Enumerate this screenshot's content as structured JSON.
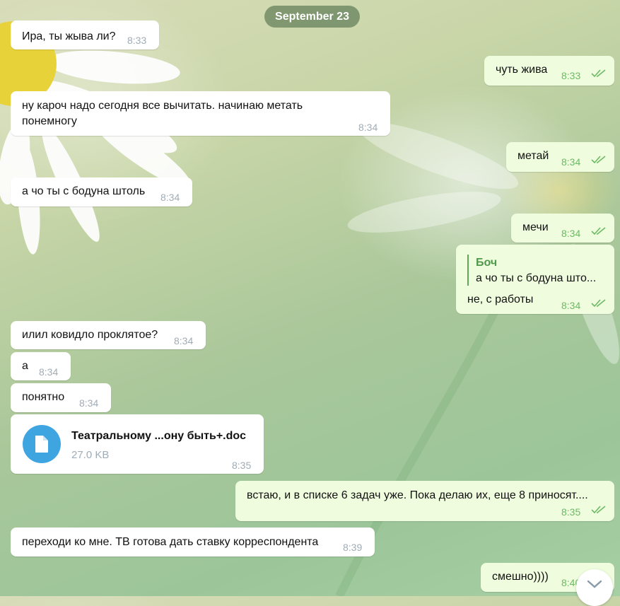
{
  "date_label": "September 23",
  "messages": [
    {
      "text": "Ира, ты жыва ли?",
      "time": "8:33"
    },
    {
      "text": "чуть жива",
      "time": "8:33"
    },
    {
      "text_line1": "ну кароч надо сегодня все вычитать. начинаю метать",
      "text_line2": "понемногу",
      "time": "8:34"
    },
    {
      "text": "метай",
      "time": "8:34"
    },
    {
      "text": "а чо ты с бодуна штоль",
      "time": "8:34"
    },
    {
      "text": "мечи",
      "time": "8:34"
    },
    {
      "reply_name": "Боч",
      "reply_text": "а чо ты с бодуна што...",
      "text": "не, с работы",
      "time": "8:34"
    },
    {
      "text": "илил ковидло проклятое?",
      "time": "8:34"
    },
    {
      "text": "а",
      "time": "8:34"
    },
    {
      "text": "понятно",
      "time": "8:34"
    },
    {
      "file_name": "Театральному ...ону быть+.doc",
      "file_size": "27.0 KB",
      "time": "8:35",
      "icon": "file-icon"
    },
    {
      "text": "встаю, и в списке 6 задач уже. Пока делаю их, еще 8 приносят....",
      "time": "8:35"
    },
    {
      "text": "переходи ко мне. ТВ готова дать ставку корреспондента",
      "time": "8:39"
    },
    {
      "text": "смешно))))",
      "time": "8:40"
    }
  ],
  "icons": {
    "read_receipt": "double-check-icon",
    "scroll": "chevron-down-icon"
  },
  "colors": {
    "incoming_bubble": "#ffffff",
    "outgoing_bubble": "#effdde",
    "outgoing_time": "#6cba64",
    "date_pill": "#69845f",
    "file_icon": "#3fa5e0"
  }
}
